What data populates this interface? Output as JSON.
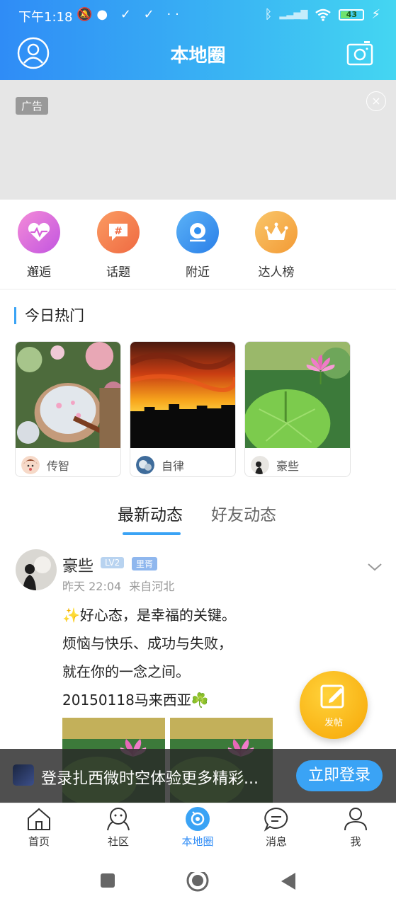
{
  "status_bar": {
    "time": "下午1:18",
    "battery": "43"
  },
  "header": {
    "title": "本地圈"
  },
  "ad": {
    "tag": "广告",
    "close_symbol": "×"
  },
  "quick_entries": [
    {
      "label": "邂逅",
      "icon": "heartbeat-icon",
      "color": "#e86ad8"
    },
    {
      "label": "话题",
      "icon": "hashtag-icon",
      "color": "#f3804c"
    },
    {
      "label": "附近",
      "icon": "location-icon",
      "color": "#2f8ff0"
    },
    {
      "label": "达人榜",
      "icon": "crown-icon",
      "color": "#f5a84a"
    }
  ],
  "hot": {
    "title": "今日热门",
    "cards": [
      {
        "user": "传智"
      },
      {
        "user": "自律"
      },
      {
        "user": "豪些"
      }
    ]
  },
  "tabs": {
    "active": "最新动态",
    "other": "好友动态"
  },
  "post": {
    "author": "豪些",
    "level_badge": "LV2",
    "vip_badge": "里胥",
    "time": "昨天 22:04",
    "location": "来自河北",
    "lines": [
      "✨好心态，是幸福的关键。",
      "烦恼与快乐、成功与失败，",
      "就在你的一念之间。",
      "20150118马来西亚☘️"
    ]
  },
  "fab": {
    "label": "发帖"
  },
  "login_banner": {
    "text": "登录扎西微时空体验更多精彩...",
    "button": "立即登录"
  },
  "bottom_nav": [
    {
      "label": "首页",
      "icon": "home-icon",
      "active": false
    },
    {
      "label": "社区",
      "icon": "community-icon",
      "active": false
    },
    {
      "label": "本地圈",
      "icon": "local-circle-icon",
      "active": true
    },
    {
      "label": "消息",
      "icon": "message-icon",
      "active": false
    },
    {
      "label": "我",
      "icon": "profile-icon",
      "active": false
    }
  ],
  "colors": {
    "accent": "#3aa3f5",
    "header_start": "#2f8cf6",
    "header_end": "#44d6f2",
    "fab": "#f9b315"
  }
}
